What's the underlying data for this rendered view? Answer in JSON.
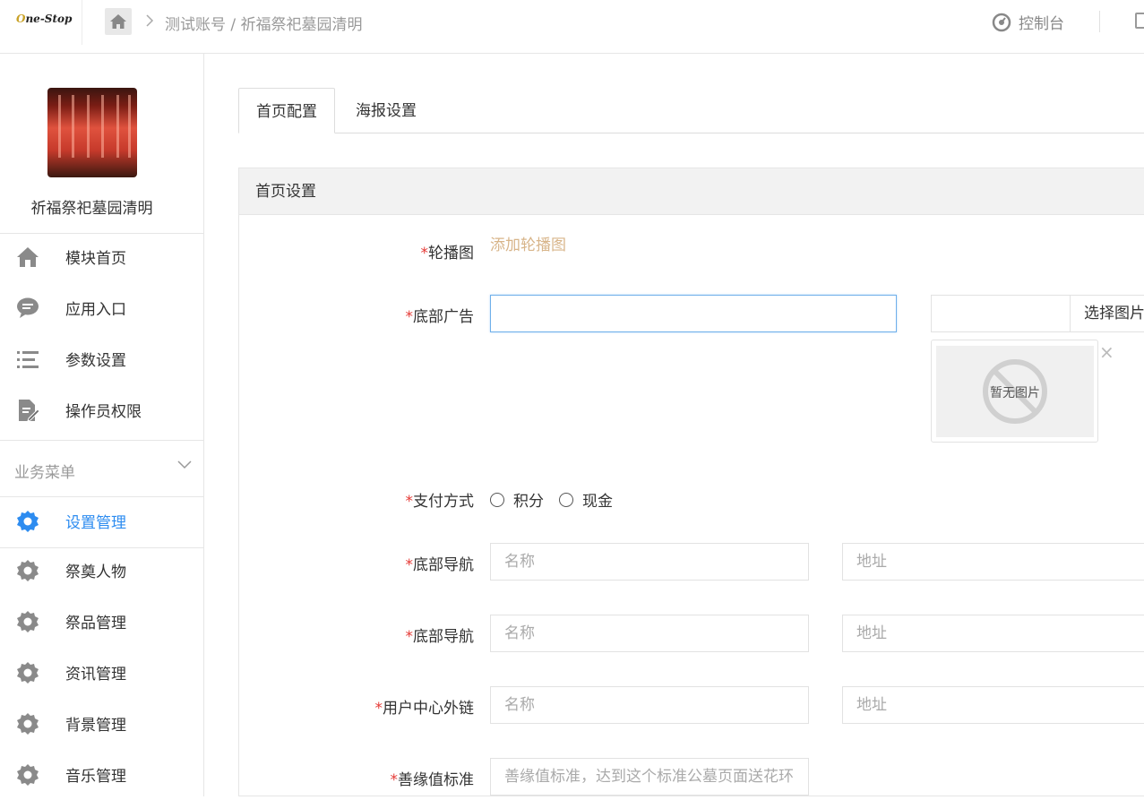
{
  "header": {
    "logo_text": "One-Stop",
    "breadcrumb": "测试账号 / 祈福祭祀墓园清明",
    "console_label": "控制台"
  },
  "sidebar": {
    "site_name": "祈福祭祀墓园清明",
    "top_items": [
      {
        "label": "模块首页",
        "icon": "home-icon"
      },
      {
        "label": "应用入口",
        "icon": "chat-icon"
      },
      {
        "label": "参数设置",
        "icon": "list-icon"
      },
      {
        "label": "操作员权限",
        "icon": "document-edit-icon"
      }
    ],
    "section_title": "业务菜单",
    "business_items": [
      {
        "label": "设置管理",
        "icon": "gear-icon",
        "active": true
      },
      {
        "label": "祭奠人物",
        "icon": "gear-icon"
      },
      {
        "label": "祭品管理",
        "icon": "gear-icon"
      },
      {
        "label": "资讯管理",
        "icon": "gear-icon"
      },
      {
        "label": "背景管理",
        "icon": "gear-icon"
      },
      {
        "label": "音乐管理",
        "icon": "gear-icon"
      }
    ],
    "active_color": "#2d8cf0"
  },
  "tabs": [
    {
      "label": "首页配置",
      "active": true
    },
    {
      "label": "海报设置",
      "active": false
    }
  ],
  "panel": {
    "title": "首页设置",
    "required_mark": "*",
    "carousel": {
      "label": "轮播图",
      "add_link": "添加轮播图"
    },
    "bottom_ad": {
      "label": "底部广告",
      "value": "",
      "image_path_value": "",
      "pick_button": "选择图片",
      "no_image_text": "暂无图片",
      "remove_symbol": "×"
    },
    "payment": {
      "label": "支付方式",
      "options": [
        "积分",
        "现金"
      ]
    },
    "nav1": {
      "label": "底部导航",
      "name_placeholder": "名称",
      "addr_placeholder": "地址"
    },
    "nav2": {
      "label": "底部导航",
      "name_placeholder": "名称",
      "addr_placeholder": "地址"
    },
    "user_link": {
      "label": "用户中心外链",
      "name_placeholder": "名称",
      "addr_placeholder": "地址"
    },
    "merit": {
      "label": "善缘值标准",
      "placeholder": "善缘值标准，达到这个标准公墓页面送花环"
    }
  }
}
